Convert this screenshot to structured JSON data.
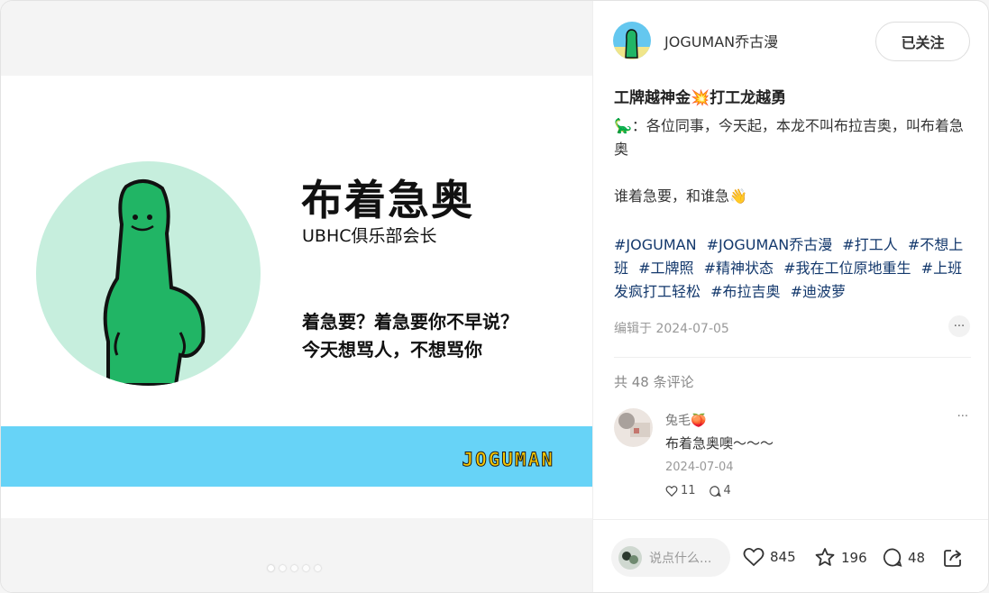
{
  "slide": {
    "title": "布着急奥",
    "subtitle": "UBHC俱乐部会长",
    "line1": "着急要？着急要你不早说？",
    "line2": "今天想骂人，不想骂你",
    "brand": "JOGUMAN"
  },
  "author": {
    "name": "JOGUMAN乔古漫",
    "follow_label": "已关注"
  },
  "note": {
    "title": "工牌越神金💥打工龙越勇",
    "body_line1": "🦕：各位同事，今天起，本龙不叫布拉吉奥，叫布着急奥",
    "body_line2": "谁着急要，和谁急👋",
    "tags": [
      "#JOGUMAN",
      "#JOGUMAN乔古漫",
      "#打工人",
      "#不想上班",
      "#工牌照",
      "#精神状态",
      "#我在工位原地重生",
      "#上班发疯打工轻松",
      "#布拉吉奥",
      "#迪波萝"
    ],
    "edited": "编辑于 2024-07-05",
    "more": "···"
  },
  "comments": {
    "count_label": "共 48 条评论",
    "items": [
      {
        "user": "兔毛🍑",
        "text": "布着急奥噢～～～",
        "date": "2024-07-04",
        "likes": "11",
        "replies": "4"
      }
    ]
  },
  "footer": {
    "placeholder": "说点什么...",
    "likes": "845",
    "stars": "196",
    "comments": "48"
  },
  "colors": {
    "band": "#67d3f7",
    "circle": "#c6eedd",
    "dino": "#21b565",
    "tag": "#13386c"
  }
}
